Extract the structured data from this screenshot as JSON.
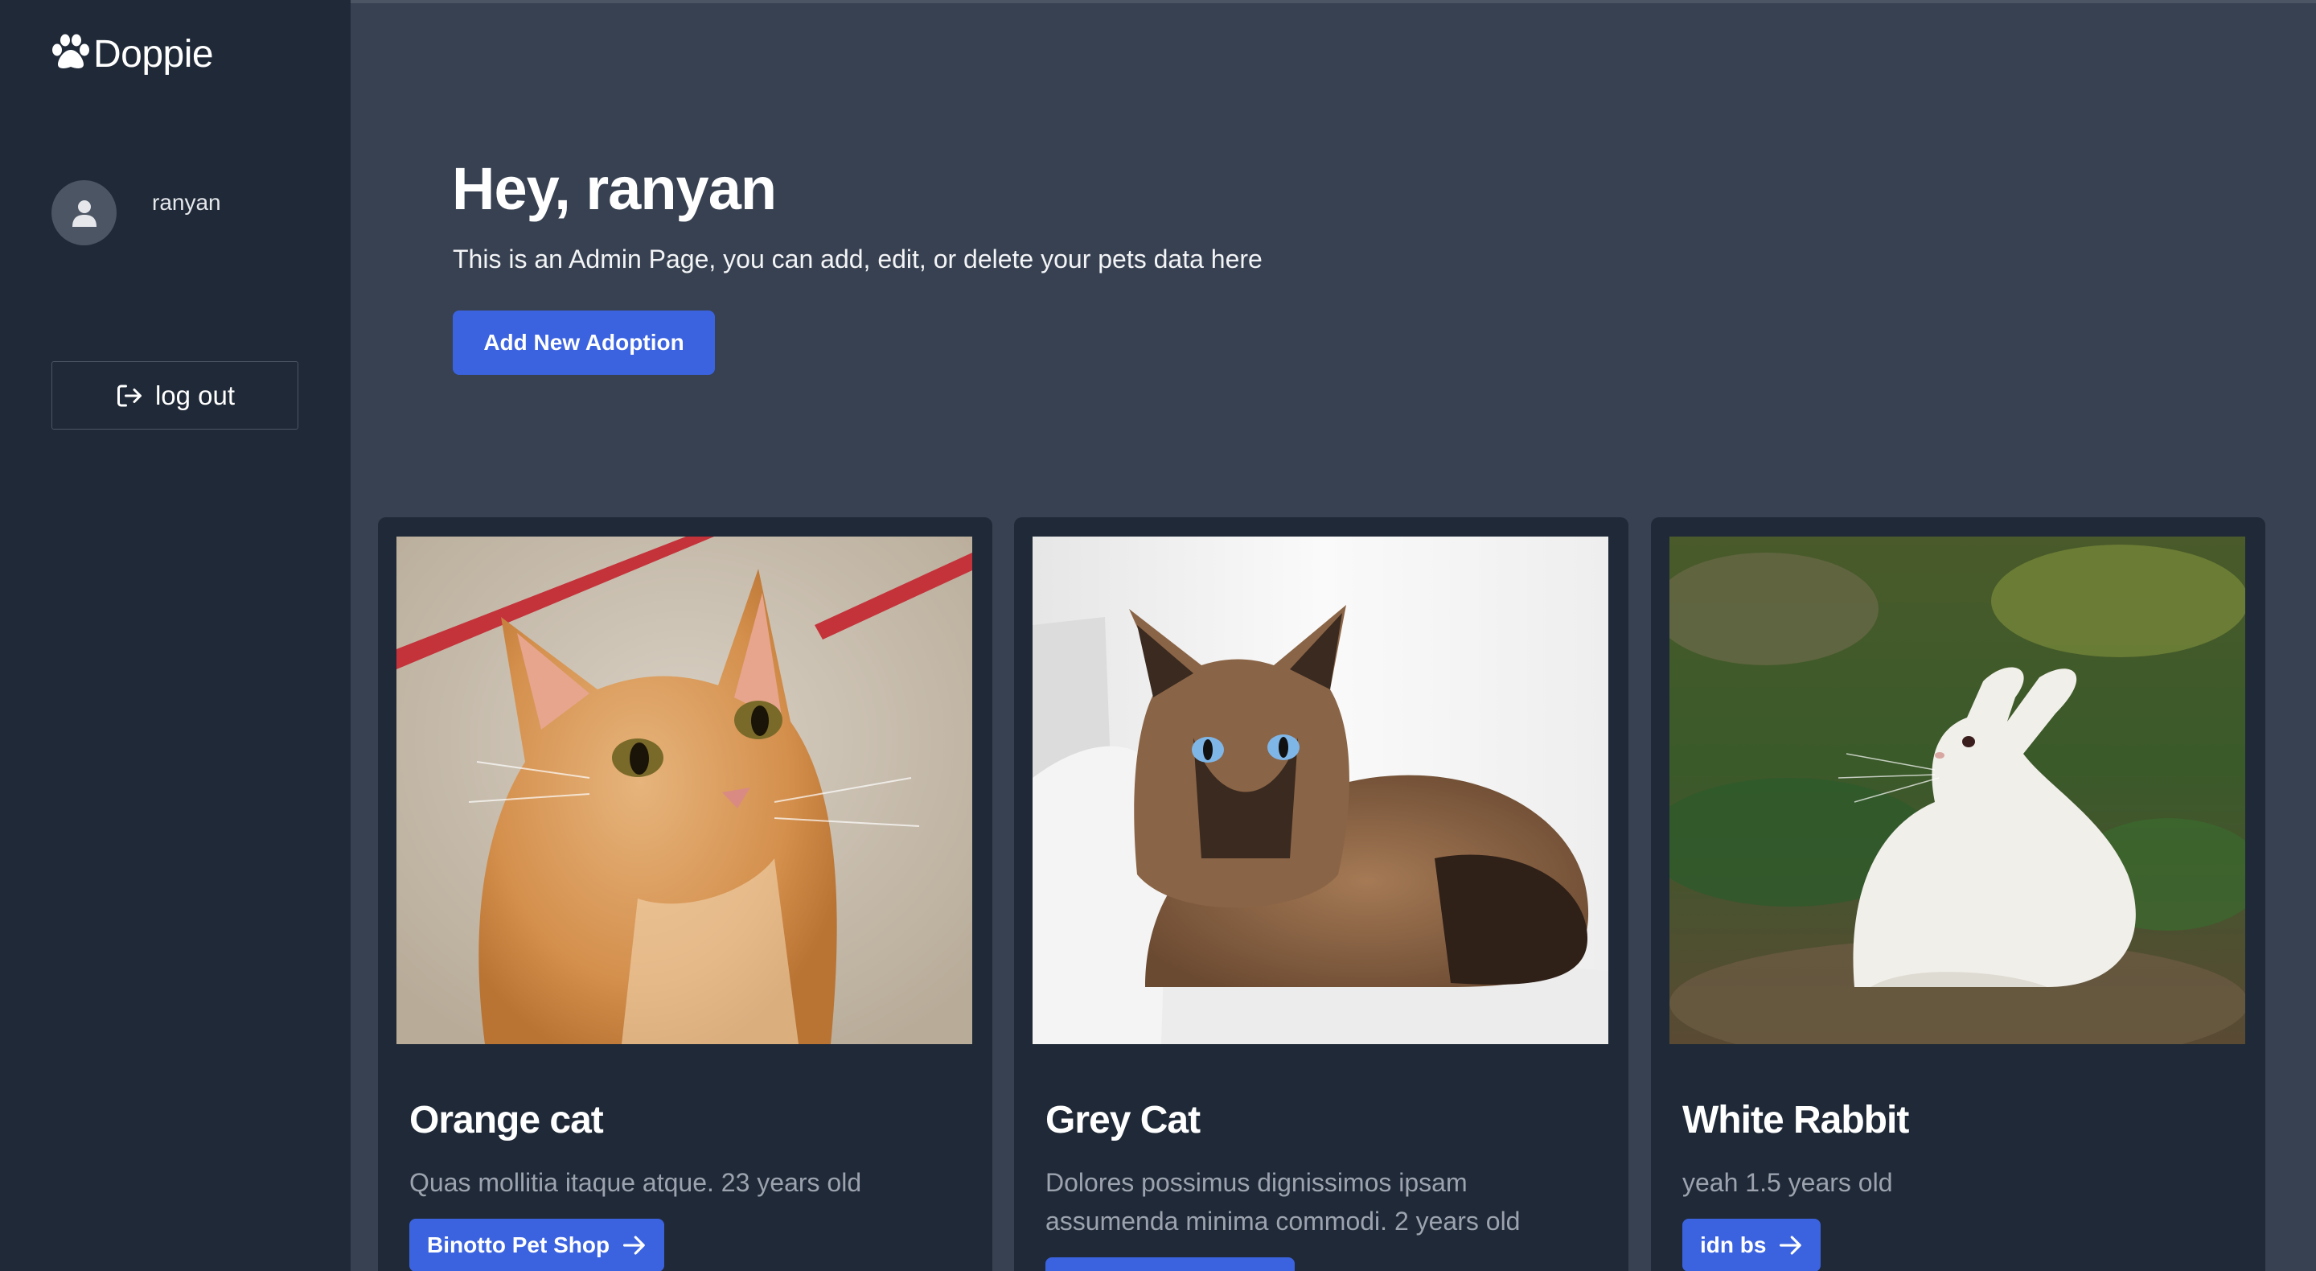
{
  "app": {
    "name": "Doppie"
  },
  "sidebar": {
    "username": "ranyan",
    "logout_label": "log out"
  },
  "hero": {
    "title": "Hey, ranyan",
    "subtitle": "This is an Admin Page, you can add, edit, or delete your pets data here",
    "add_button": "Add New Adoption"
  },
  "pets": [
    {
      "name": "Orange cat",
      "description": "Quas mollitia itaque atque. 23 years old",
      "shop": "Binotto Pet Shop"
    },
    {
      "name": "Grey Cat",
      "description": "Dolores possimus dignissimos ipsam assumenda minima commodi. 2 years old",
      "shop": ""
    },
    {
      "name": "White Rabbit",
      "description": "yeah 1.5 years old",
      "shop": "idn bs"
    }
  ],
  "colors": {
    "sidebar_bg": "#1f2937",
    "page_bg": "#374151",
    "card_bg": "#1f2937",
    "accent": "#3b63e0"
  }
}
